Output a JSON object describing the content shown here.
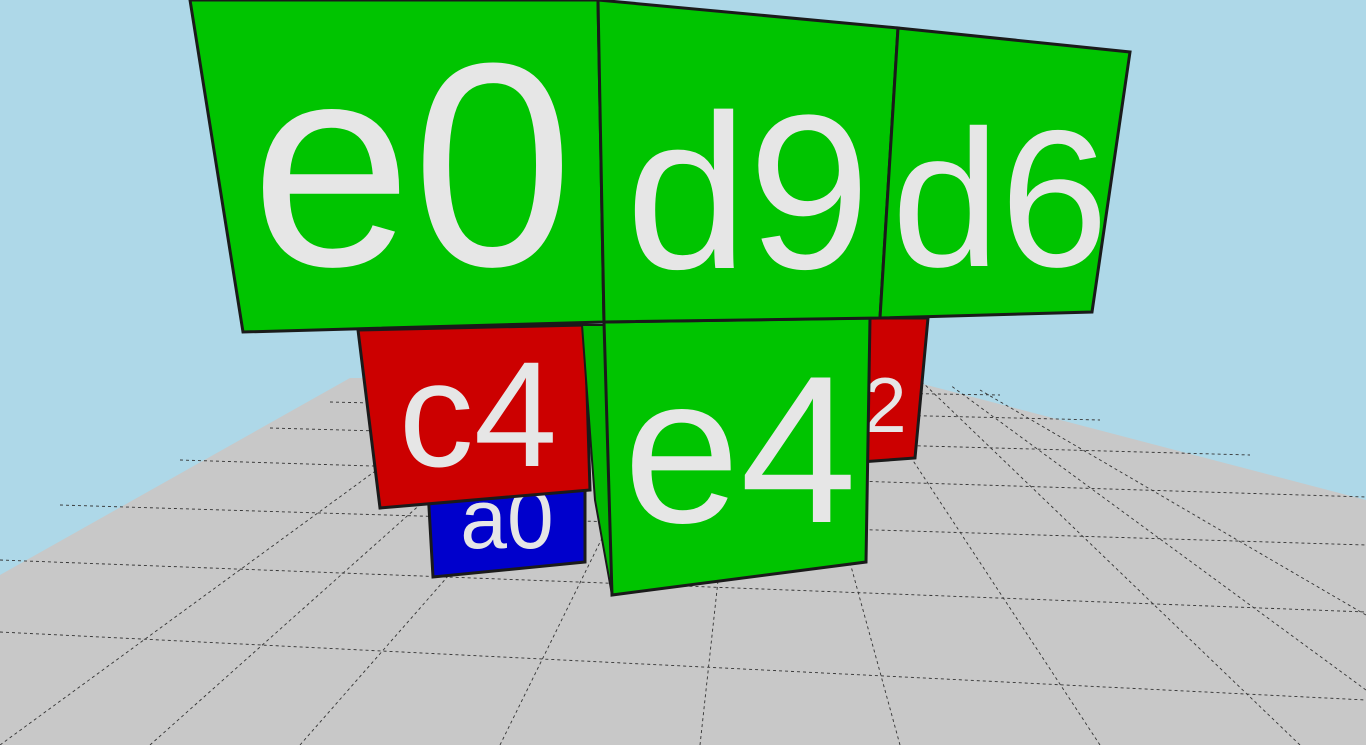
{
  "scene": {
    "sky_color": "#aed8e8",
    "floor_color": "#c8c8c8",
    "grid_line_color": "#333333",
    "edge_color": "#1a1a1a",
    "label_color": "#e6e6e6"
  },
  "blocks": {
    "e0": {
      "label": "e0",
      "color": "#00c400"
    },
    "d9": {
      "label": "d9",
      "color": "#00c400"
    },
    "d6": {
      "label": "d6",
      "color": "#00c400"
    },
    "c4": {
      "label": "c4",
      "color": "#cc0000"
    },
    "e4": {
      "label": "e4",
      "color": "#00c400"
    },
    "a0": {
      "label": "a0",
      "color": "#0000cc"
    },
    "partial_right": {
      "label": "2",
      "color": "#cc0000"
    }
  }
}
